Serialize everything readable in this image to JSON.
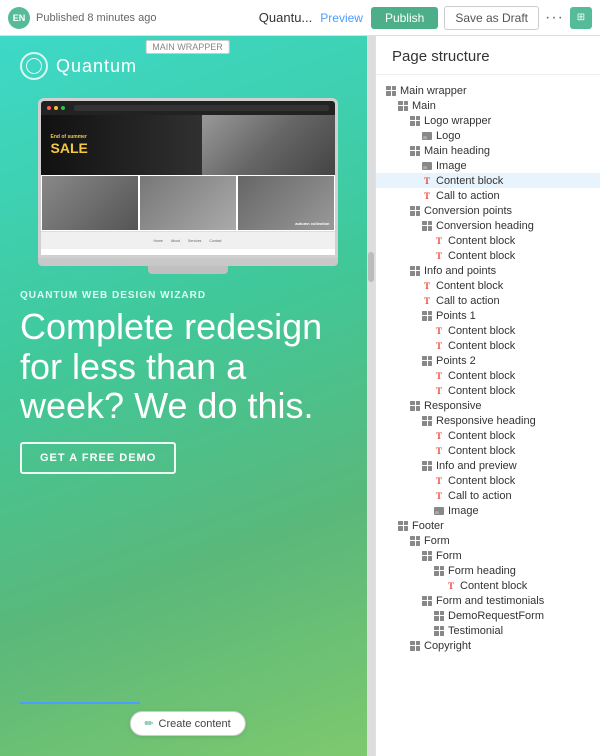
{
  "topbar": {
    "flag_label": "EN",
    "status": "Published 8 minutes ago",
    "title": "Quantu...",
    "preview_label": "Preview",
    "publish_label": "Publish",
    "draft_label": "Save as Draft",
    "more_label": "···",
    "user_initials": "▣"
  },
  "canvas": {
    "main_wrapper_label": "MAIN WRAPPER",
    "logo_text": "Quantum",
    "eyebrow": "QUANTUM WEB DESIGN WIZARD",
    "headline": "Complete redesign for less than a week? We do this.",
    "cta": "GET A FREE DEMO",
    "create_content": "Create content",
    "hero_small": "End of summer",
    "hero_sale": "SALE",
    "autumn_label": "autumn collection"
  },
  "panel": {
    "title": "Page structure",
    "tree": [
      {
        "level": 0,
        "icon": "grid",
        "label": "Main wrapper"
      },
      {
        "level": 1,
        "icon": "grid",
        "label": "Main"
      },
      {
        "level": 2,
        "icon": "grid",
        "label": "Logo wrapper"
      },
      {
        "level": 3,
        "icon": "image",
        "label": "Logo"
      },
      {
        "level": 2,
        "icon": "grid",
        "label": "Main heading"
      },
      {
        "level": 3,
        "icon": "image",
        "label": "Image"
      },
      {
        "level": 3,
        "icon": "T",
        "label": "Content block",
        "highlight": true
      },
      {
        "level": 3,
        "icon": "T",
        "label": "Call to action"
      },
      {
        "level": 2,
        "icon": "grid",
        "label": "Conversion points"
      },
      {
        "level": 3,
        "icon": "grid",
        "label": "Conversion heading"
      },
      {
        "level": 4,
        "icon": "T",
        "label": "Content block"
      },
      {
        "level": 4,
        "icon": "T",
        "label": "Content block"
      },
      {
        "level": 2,
        "icon": "grid",
        "label": "Info and points"
      },
      {
        "level": 3,
        "icon": "T",
        "label": "Content block"
      },
      {
        "level": 3,
        "icon": "T",
        "label": "Call to action"
      },
      {
        "level": 3,
        "icon": "grid",
        "label": "Points 1"
      },
      {
        "level": 4,
        "icon": "T",
        "label": "Content block"
      },
      {
        "level": 4,
        "icon": "T",
        "label": "Content block"
      },
      {
        "level": 3,
        "icon": "grid",
        "label": "Points 2"
      },
      {
        "level": 4,
        "icon": "T",
        "label": "Content block"
      },
      {
        "level": 4,
        "icon": "T",
        "label": "Content block"
      },
      {
        "level": 2,
        "icon": "grid",
        "label": "Responsive"
      },
      {
        "level": 3,
        "icon": "grid",
        "label": "Responsive heading"
      },
      {
        "level": 4,
        "icon": "T",
        "label": "Content block"
      },
      {
        "level": 4,
        "icon": "T",
        "label": "Content block"
      },
      {
        "level": 3,
        "icon": "grid",
        "label": "Info and preview"
      },
      {
        "level": 4,
        "icon": "T",
        "label": "Content block"
      },
      {
        "level": 4,
        "icon": "T",
        "label": "Call to action"
      },
      {
        "level": 4,
        "icon": "image",
        "label": "Image"
      },
      {
        "level": 1,
        "icon": "grid",
        "label": "Footer"
      },
      {
        "level": 2,
        "icon": "grid",
        "label": "Form"
      },
      {
        "level": 3,
        "icon": "grid",
        "label": "Form"
      },
      {
        "level": 4,
        "icon": "grid",
        "label": "Form heading"
      },
      {
        "level": 5,
        "icon": "T",
        "label": "Content block"
      },
      {
        "level": 3,
        "icon": "grid",
        "label": "Form and testimonials"
      },
      {
        "level": 4,
        "icon": "grid",
        "label": "DemoRequestForm"
      },
      {
        "level": 4,
        "icon": "grid",
        "label": "Testimonial"
      },
      {
        "level": 2,
        "icon": "grid",
        "label": "Copyright"
      }
    ]
  }
}
